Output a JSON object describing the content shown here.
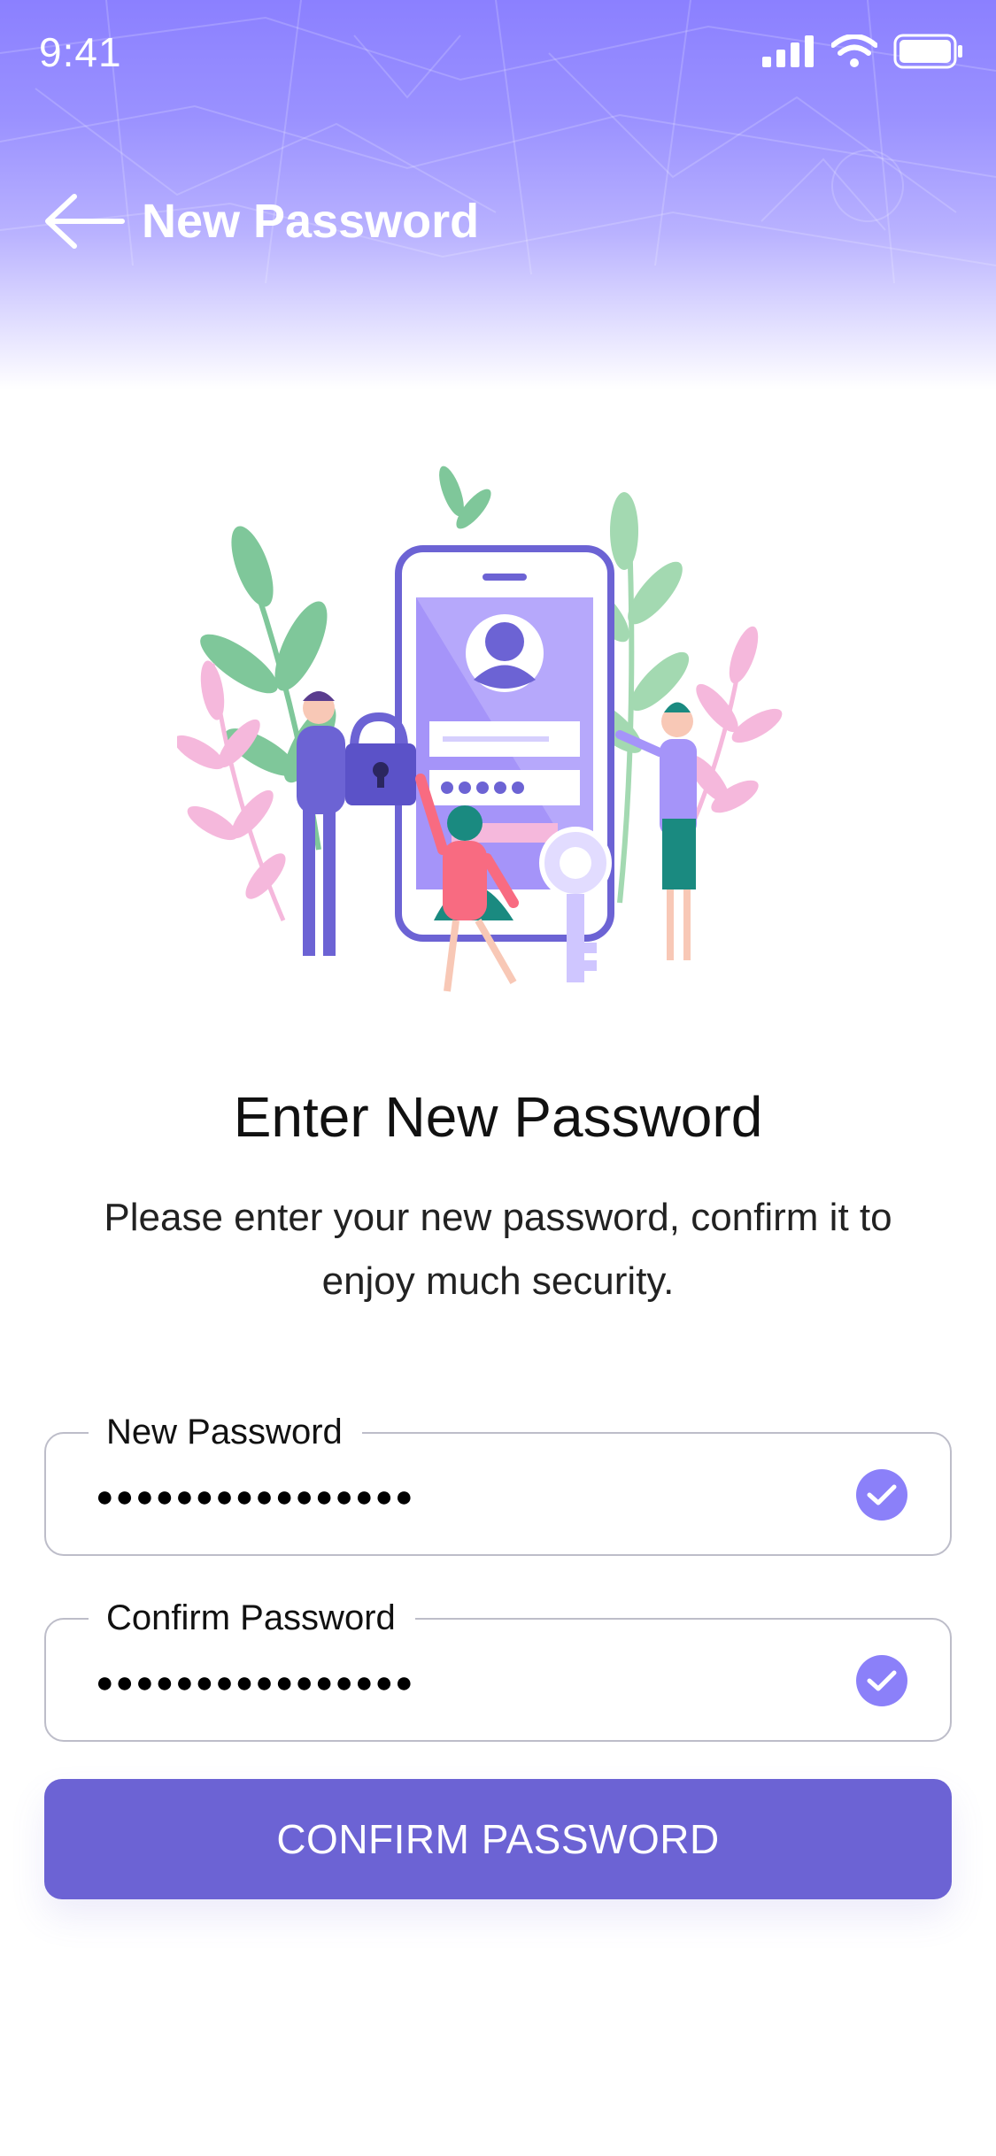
{
  "status_bar": {
    "time": "9:41"
  },
  "nav": {
    "title": "New Password"
  },
  "content": {
    "heading": "Enter New Password",
    "description": "Please enter your new password, confirm it to enjoy much security."
  },
  "form": {
    "new_password": {
      "label": "New Password",
      "value": "●●●●●●●●●●●●●●●●",
      "valid": true
    },
    "confirm_password": {
      "label": "Confirm Password",
      "value": "●●●●●●●●●●●●●●●●",
      "valid": true
    }
  },
  "button": {
    "label": "CONFIRM PASSWORD"
  },
  "colors": {
    "primary": "#6c63d4",
    "accent": "#8b80f9",
    "header_top": "#8b80ff"
  }
}
